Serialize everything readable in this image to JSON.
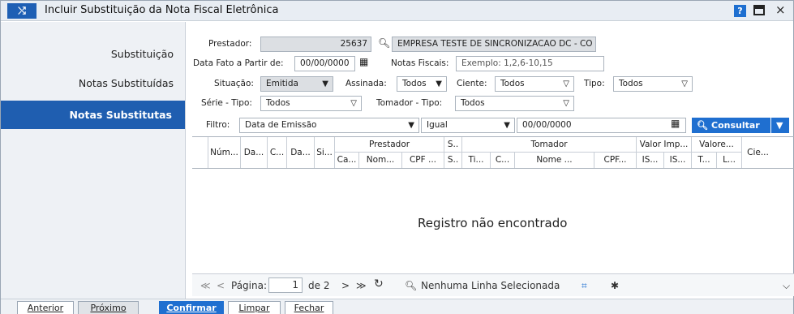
{
  "title": {
    "icon": "⤭",
    "text": "Incluir Substituição da Nota Fiscal Eletrônica",
    "help": "?",
    "close": "×"
  },
  "sidebar": {
    "items": [
      {
        "label": "Substituição"
      },
      {
        "label": "Notas Substituídas"
      },
      {
        "label": "Notas Substitutas"
      }
    ]
  },
  "form": {
    "prestador_label": "Prestador:",
    "prestador_code": "25637",
    "prestador_name": "EMPRESA TESTE DE SINCRONIZACAO DC - CO",
    "data_fato_label": "Data Fato a Partir de:",
    "data_fato_value": "00/00/0000",
    "notas_fiscais_label": "Notas Fiscais:",
    "notas_fiscais_placeholder": "Exemplo: 1,2,6-10,15",
    "situacao_label": "Situação:",
    "situacao_value": "Emitida",
    "assinada_label": "Assinada:",
    "assinada_value": "Todos",
    "ciente_label": "Ciente:",
    "ciente_value": "Todos",
    "tipo_label": "Tipo:",
    "tipo_value": "Todos",
    "serie_tipo_label": "Série - Tipo:",
    "serie_tipo_value": "Todos",
    "tomador_tipo_label": "Tomador - Tipo:",
    "tomador_tipo_value": "Todos",
    "filtro_label": "Filtro:",
    "filtro_field": "Data de Emissão",
    "filtro_op": "Igual",
    "filtro_value": "00/00/0000",
    "consultar_label": "Consultar"
  },
  "grid": {
    "group_headers": [
      "Prestador",
      "S..",
      "Tomador",
      "Valor Imp...",
      "Valore..."
    ],
    "columns": [
      "Núm...",
      "Da...",
      "C...",
      "Da...",
      "Si...",
      "Ca...",
      "Nom...",
      "CPF ...",
      "S..",
      "Ti...",
      "C...",
      "Nome ...",
      "CPF...",
      "IS...",
      "IS...",
      "T...",
      "L...",
      "Cie..."
    ],
    "empty_message": "Registro não encontrado"
  },
  "pager": {
    "page_label": "Página:",
    "page_value": "1",
    "of_label": "de 2",
    "selection_status": "Nenhuma Linha Selecionada"
  },
  "footer": {
    "anterior": "Anterior",
    "proximo": "Próximo",
    "confirmar": "Confirmar",
    "limpar": "Limpar",
    "fechar": "Fechar"
  }
}
